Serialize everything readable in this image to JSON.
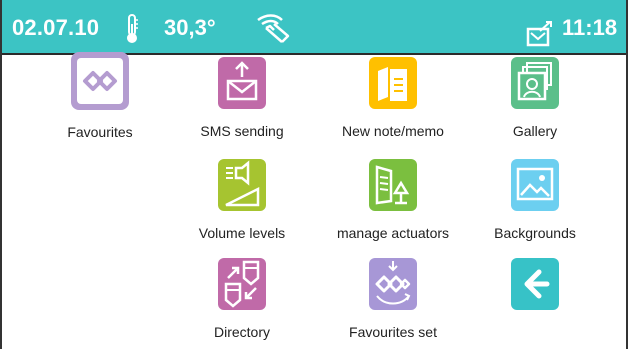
{
  "status_bar": {
    "date": "02.07.10",
    "temperature": "30,3°",
    "time": "11:18",
    "icons": [
      "thermometer-icon",
      "touch-hand-icon",
      "message-icon"
    ],
    "color": "#3cc4c4"
  },
  "apps": [
    {
      "label": "Favourites",
      "icon": "favourites-icon",
      "color": "#b49cd0"
    },
    {
      "label": "SMS sending",
      "icon": "sms-envelope-icon",
      "color": "#c06aa8"
    },
    {
      "label": "New note/memo",
      "icon": "note-icon",
      "color": "#ffc000"
    },
    {
      "label": "Gallery",
      "icon": "gallery-icon",
      "color": "#5bbf8a"
    },
    {
      "label": "Volume levels",
      "icon": "volume-icon",
      "color": "#a6c430"
    },
    {
      "label": "manage actuators",
      "icon": "actuators-icon",
      "color": "#7bbf3f"
    },
    {
      "label": "Backgrounds",
      "icon": "backgrounds-icon",
      "color": "#6ccff0"
    },
    {
      "label": "Directory",
      "icon": "directory-icon",
      "color": "#c06aa8"
    },
    {
      "label": "Favourites set",
      "icon": "favourites-set-icon",
      "color": "#a797d6"
    }
  ],
  "back": {
    "icon": "back-arrow-icon",
    "color": "#37c2c7"
  }
}
